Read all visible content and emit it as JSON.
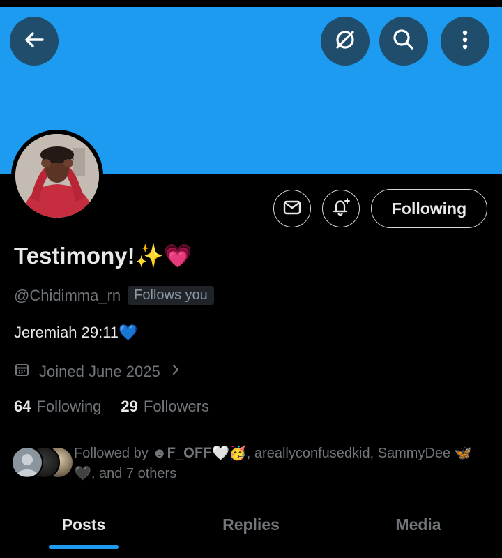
{
  "header": {
    "back_icon": "arrow-left-icon",
    "grok_icon": "slashed-circle-icon",
    "search_icon": "search-icon",
    "more_icon": "more-vertical-icon",
    "banner_color": "#1d9bf0"
  },
  "profile": {
    "display_name": "Testimony!✨💗",
    "handle": "@Chidimma_rn",
    "follows_you_badge": "Follows you",
    "bio": "Jeremiah 29:11💙",
    "joined": "Joined June 2025",
    "following_count": "64",
    "following_label": "Following",
    "followers_count": "29",
    "followers_label": "Followers"
  },
  "actions": {
    "message_icon": "envelope-icon",
    "notify_icon": "bell-plus-icon",
    "following_button_label": "Following"
  },
  "followed_by": {
    "text": "Followed by ☻𝐅_𝐎𝐅𝐅🤍🥳, areallyconfusedkid, SammyDee 🦋🖤, and 7 others"
  },
  "tabs": [
    {
      "label": "Posts",
      "active": true
    },
    {
      "label": "Replies",
      "active": false
    },
    {
      "label": "Media",
      "active": false
    }
  ],
  "colors": {
    "accent": "#1d9bf0",
    "background": "#000000",
    "secondary_text": "#71767b"
  }
}
